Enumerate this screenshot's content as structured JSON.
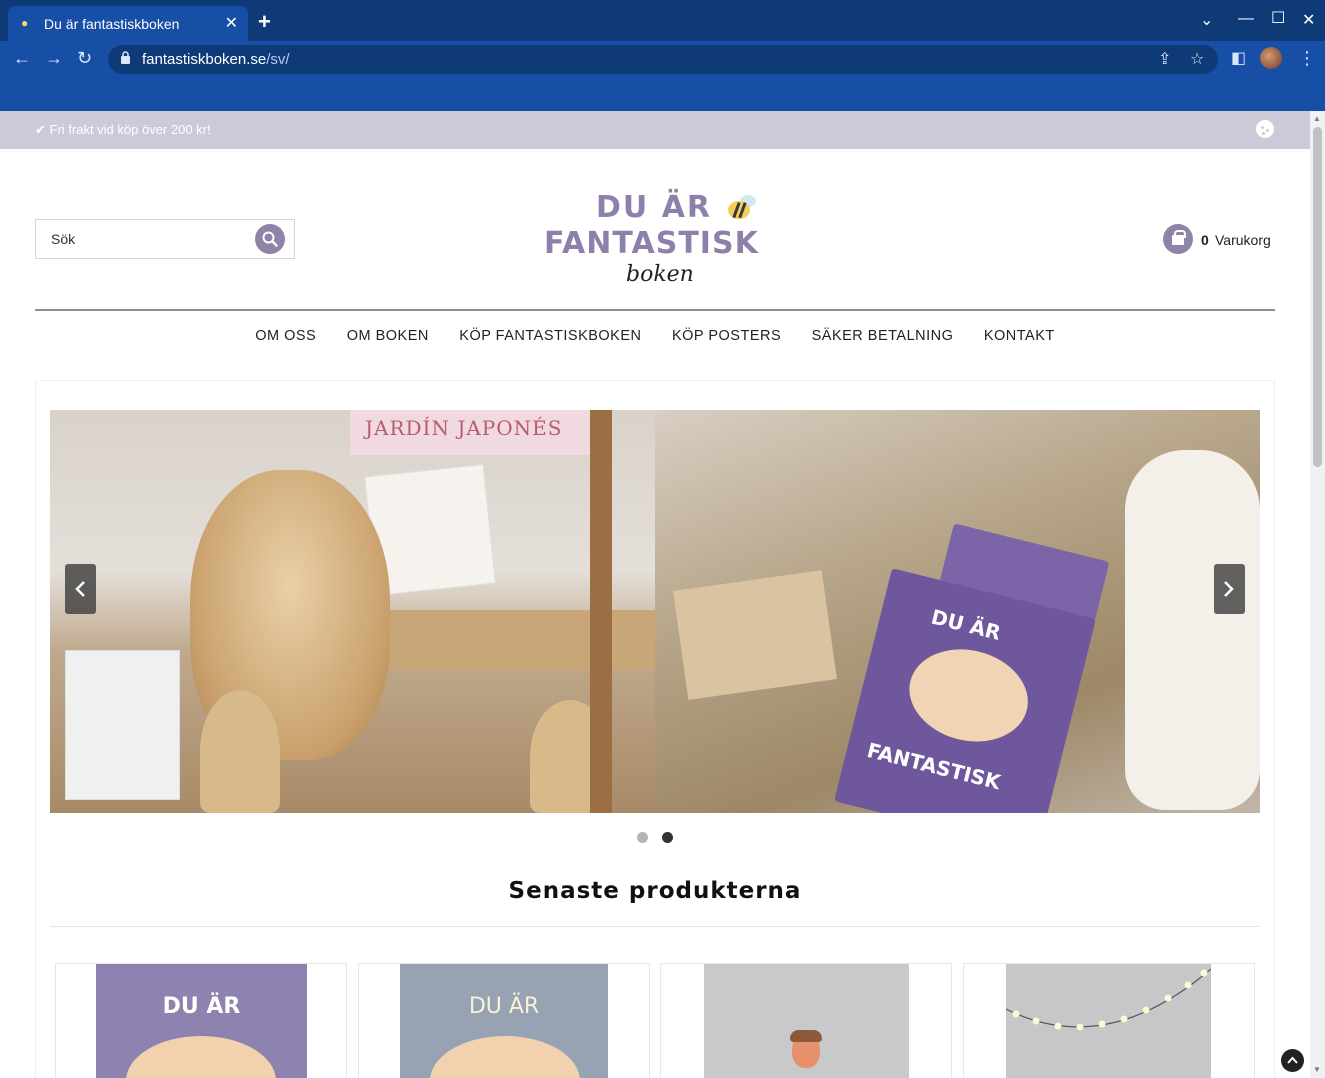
{
  "browser": {
    "tab_title": "Du är fantastiskboken",
    "tab_favicon": "bee-icon",
    "url_domain": "fantastiskboken.se",
    "url_path": "/sv/"
  },
  "topbar": {
    "message": "✔ Fri frakt vid köp över 200 kr!"
  },
  "search": {
    "placeholder": "Sök"
  },
  "logo": {
    "line1": "DU ÄR",
    "line2": "FANTASTISK",
    "line3": "boken"
  },
  "cart": {
    "count": "0",
    "label": "Varukorg"
  },
  "nav": {
    "items": [
      {
        "label": "OM OSS"
      },
      {
        "label": "OM BOKEN"
      },
      {
        "label": "KÖP FANTASTISKBOKEN"
      },
      {
        "label": "KÖP POSTERS"
      },
      {
        "label": "SÄKER BETALNING"
      },
      {
        "label": "KONTAKT"
      }
    ]
  },
  "slider": {
    "sign_text": "JARDÍN JAPONÉS",
    "book_title_top": "DU ÄR",
    "book_title_bottom": "FANTASTISK",
    "active_slide": 2,
    "total_slides": 2
  },
  "latest": {
    "title": "Senaste produkterna",
    "cards": [
      {
        "cover_text": "DU ÄR"
      },
      {
        "cover_text": "DU ÄR"
      },
      {
        "cover_text": ""
      },
      {
        "cover_text": ""
      }
    ]
  },
  "colors": {
    "brand_purple": "#8f83a8",
    "topbar_bg": "#cdc9d9",
    "browser_blue": "#174ea6"
  }
}
